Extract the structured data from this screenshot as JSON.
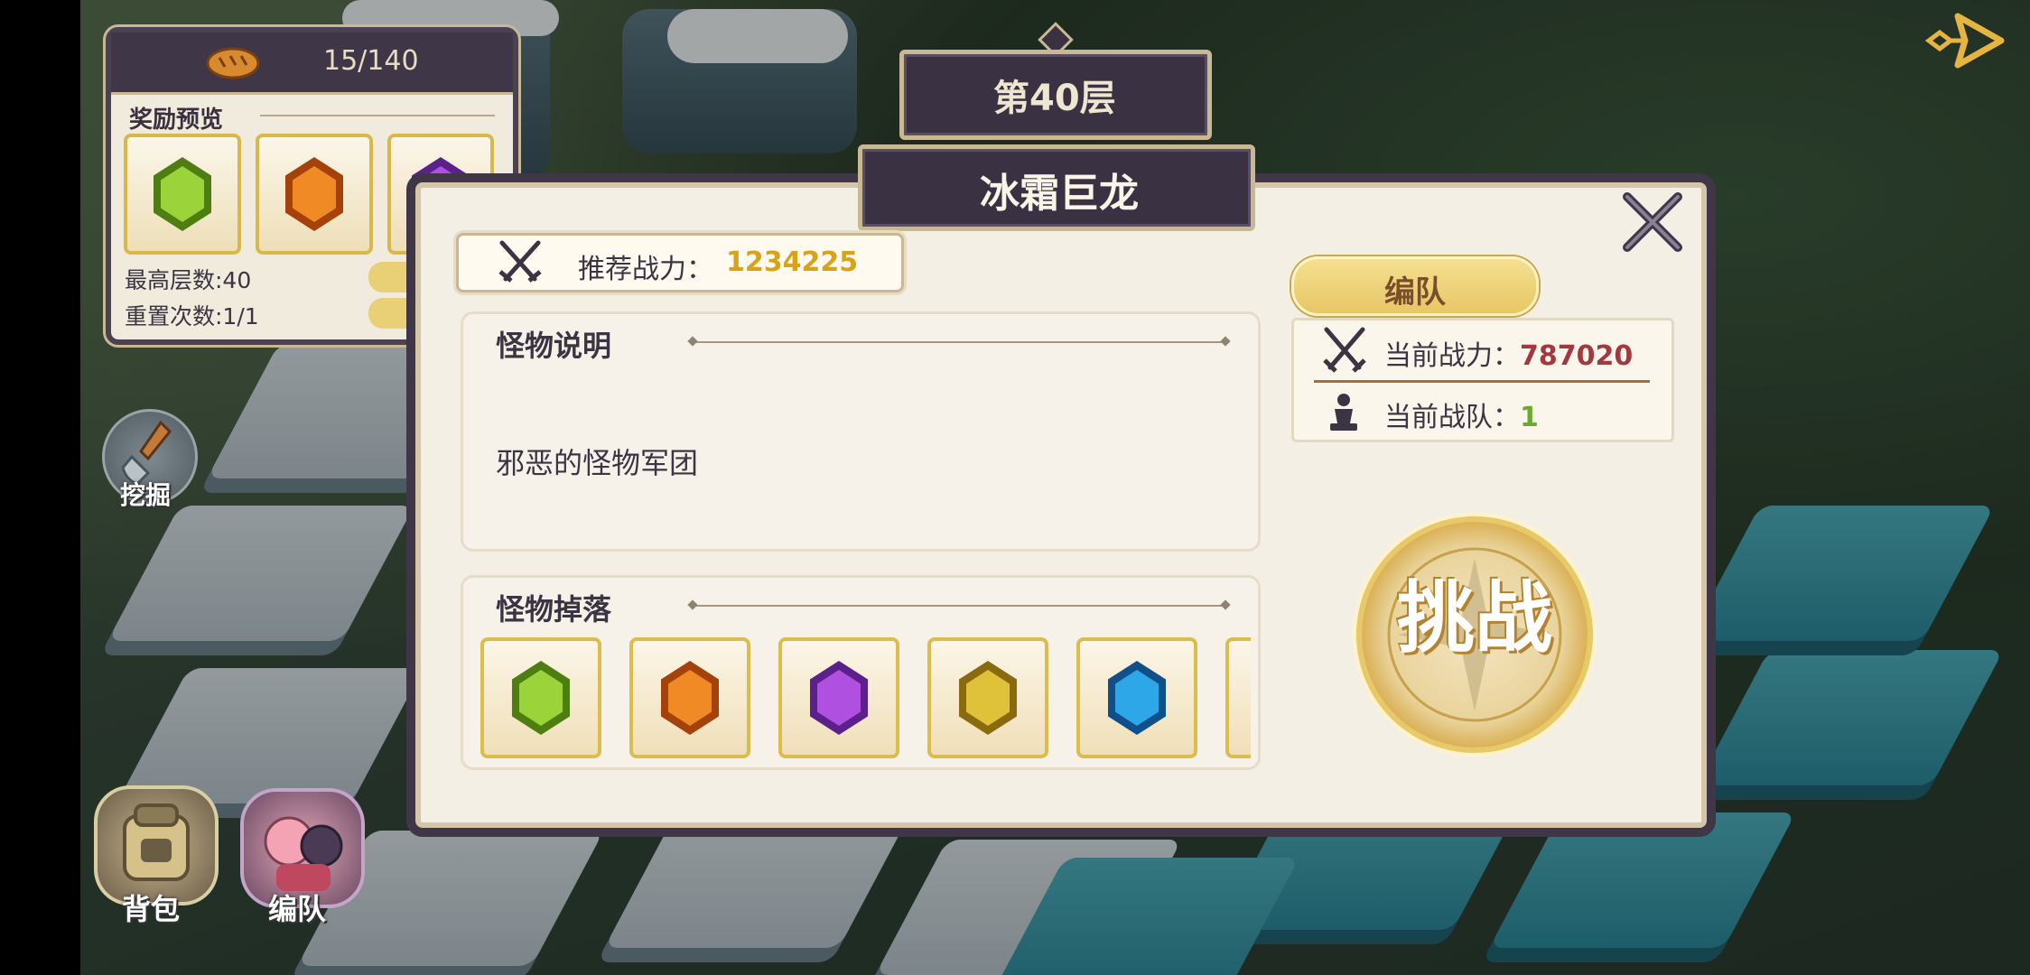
{
  "resource": {
    "icon": "bread-icon",
    "count": "15/140"
  },
  "reward_preview": {
    "title": "奖励预览",
    "gems": [
      "green-gem-icon",
      "orange-gem-icon",
      "purple-gem-icon"
    ]
  },
  "stats": {
    "max_floor": "最高层数:40",
    "reset_count": "重置次数:1/1"
  },
  "side": {
    "dig_label": "挖掘",
    "bag_label": "背包",
    "team_label": "编队"
  },
  "floor": {
    "label": "第40层"
  },
  "dialog": {
    "title": "冰霜巨龙",
    "recommended_label": "推荐战力：",
    "recommended_value": "1234225",
    "monster_desc_title": "怪物说明",
    "monster_desc_text": "邪恶的怪物军团",
    "drops_title": "怪物掉落",
    "drops": [
      "green-gem-icon",
      "orange-gem-icon",
      "purple-gem-icon",
      "gold-gem-icon",
      "blue-gem-icon"
    ],
    "team_button": "编队",
    "current_power_label": "当前战力：",
    "current_power_value": "787020",
    "current_team_label": "当前战队：",
    "current_team_value": "1",
    "challenge_label": "挑战"
  },
  "colors": {
    "gold": "#d9a219",
    "power_red": "#a3383f",
    "team_green": "#6aaa31",
    "frame": "#3f3648"
  }
}
